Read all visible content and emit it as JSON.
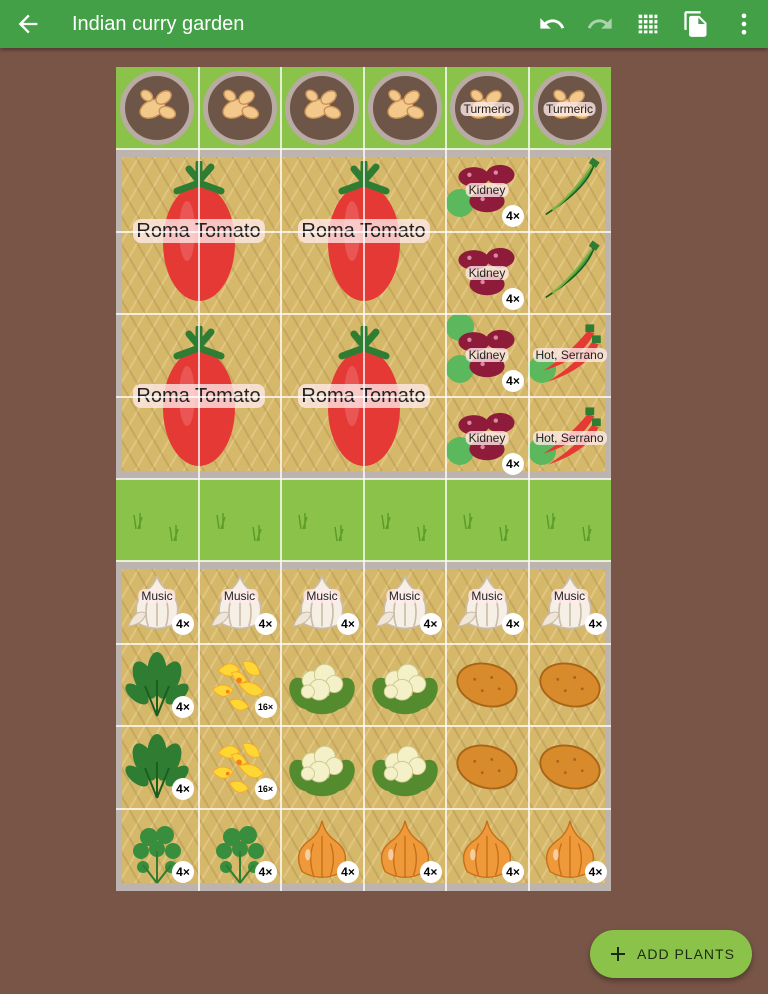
{
  "app": {
    "title": "Indian curry garden"
  },
  "toolbar": {
    "back_icon": "arrow-left-icon",
    "undo_icon": "undo-icon",
    "redo_icon": "redo-icon",
    "grid_icon": "grid-toggle-icon",
    "pages_icon": "file-copy-icon",
    "more_icon": "more-vert-icon"
  },
  "colors": {
    "appbar": "#43a047",
    "background": "#795548",
    "fab": "#8bc34a",
    "grass": "#8bc34a"
  },
  "garden": {
    "rows": [
      {
        "type": "pots",
        "plants": [
          {
            "plant": "ginger",
            "label": ""
          },
          {
            "plant": "ginger",
            "label": ""
          },
          {
            "plant": "ginger",
            "label": ""
          },
          {
            "plant": "ginger",
            "label": ""
          },
          {
            "plant": "ginger",
            "label": "Turmeric"
          },
          {
            "plant": "ginger",
            "label": "Turmeric"
          }
        ]
      },
      {
        "type": "bed",
        "big_plants": [
          {
            "plant": "tomato",
            "label": "Roma Tomato"
          },
          {
            "plant": "tomato",
            "label": "Roma Tomato"
          },
          {
            "plant": "tomato",
            "label": "Roma Tomato"
          },
          {
            "plant": "tomato",
            "label": "Roma Tomato"
          }
        ],
        "small_plants": [
          {
            "plant": "kidney-bean",
            "label": "Kidney",
            "count": "4×"
          },
          {
            "plant": "okra",
            "label": "",
            "count": ""
          },
          {
            "plant": "kidney-bean",
            "label": "Kidney",
            "count": "4×"
          },
          {
            "plant": "okra",
            "label": "",
            "count": ""
          },
          {
            "plant": "kidney-bean",
            "label": "Kidney",
            "count": "4×"
          },
          {
            "plant": "chili",
            "label": "Hot, Serrano",
            "count": ""
          },
          {
            "plant": "kidney-bean",
            "label": "Kidney",
            "count": "4×"
          },
          {
            "plant": "chili",
            "label": "Hot, Serrano",
            "count": ""
          }
        ]
      },
      {
        "type": "grass"
      },
      {
        "type": "bed",
        "grid": [
          [
            {
              "plant": "garlic",
              "label": "Music",
              "count": "4×"
            },
            {
              "plant": "garlic",
              "label": "Music",
              "count": "4×"
            },
            {
              "plant": "garlic",
              "label": "Music",
              "count": "4×"
            },
            {
              "plant": "garlic",
              "label": "Music",
              "count": "4×"
            },
            {
              "plant": "garlic",
              "label": "Music",
              "count": "4×"
            },
            {
              "plant": "garlic",
              "label": "Music",
              "count": "4×"
            }
          ],
          [
            {
              "plant": "spinach",
              "label": "",
              "count": "4×"
            },
            {
              "plant": "yellow-flower",
              "label": "",
              "count": "16×"
            },
            {
              "plant": "cauliflower",
              "label": "",
              "count": ""
            },
            {
              "plant": "cauliflower",
              "label": "",
              "count": ""
            },
            {
              "plant": "potato",
              "label": "",
              "count": ""
            },
            {
              "plant": "potato",
              "label": "",
              "count": ""
            }
          ],
          [
            {
              "plant": "spinach",
              "label": "",
              "count": "4×"
            },
            {
              "plant": "yellow-flower",
              "label": "",
              "count": "16×"
            },
            {
              "plant": "cauliflower",
              "label": "",
              "count": ""
            },
            {
              "plant": "cauliflower",
              "label": "",
              "count": ""
            },
            {
              "plant": "potato",
              "label": "",
              "count": ""
            },
            {
              "plant": "potato",
              "label": "",
              "count": ""
            }
          ],
          [
            {
              "plant": "cilantro",
              "label": "",
              "count": "4×"
            },
            {
              "plant": "cilantro",
              "label": "",
              "count": "4×"
            },
            {
              "plant": "onion",
              "label": "",
              "count": "4×"
            },
            {
              "plant": "onion",
              "label": "",
              "count": "4×"
            },
            {
              "plant": "onion",
              "label": "",
              "count": "4×"
            },
            {
              "plant": "onion",
              "label": "",
              "count": "4×"
            }
          ]
        ]
      }
    ]
  },
  "fab": {
    "label": "ADD PLANTS",
    "icon": "plus-icon"
  }
}
